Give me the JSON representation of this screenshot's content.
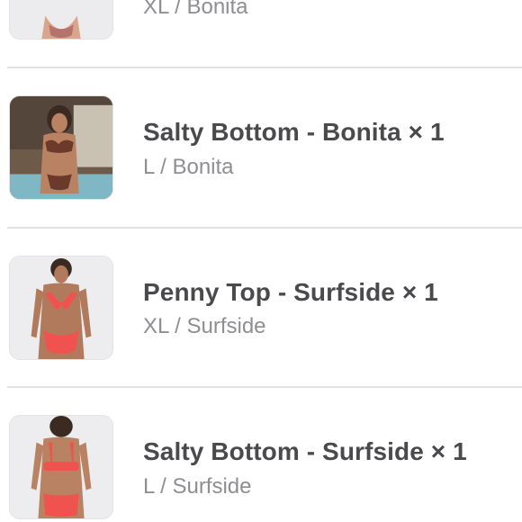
{
  "order_items": [
    {
      "title": "",
      "variant": "XL / Bonita",
      "thumbnail": "product-photo-bonita-top"
    },
    {
      "title": "Salty Bottom - Bonita × 1",
      "variant": "L / Bonita",
      "thumbnail": "product-photo-bonita-bottom"
    },
    {
      "title": "Penny Top - Surfside × 1",
      "variant": "XL / Surfside",
      "thumbnail": "product-photo-surfside-top"
    },
    {
      "title": "Salty Bottom - Surfside × 1",
      "variant": "L / Surfside",
      "thumbnail": "product-photo-surfside-bottom"
    }
  ],
  "colors": {
    "title_text": "#4a4a4c",
    "subtitle_text": "#8e8e93",
    "divider": "#e2e2e5",
    "bonita_swimwear": "#6b3a2a",
    "surfside_swimwear": "#f0524f"
  }
}
